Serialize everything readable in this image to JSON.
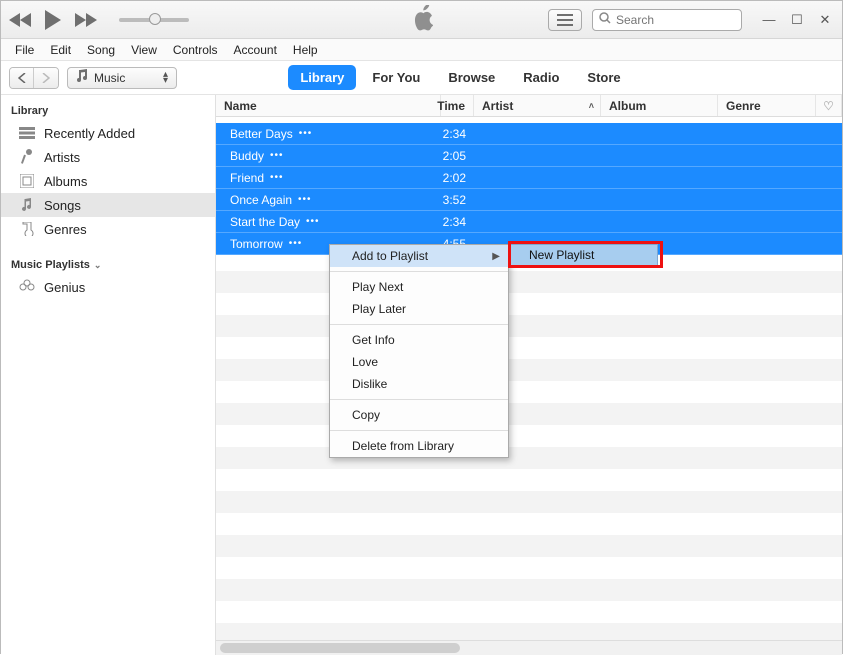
{
  "search": {
    "placeholder": "Search"
  },
  "menubar": [
    "File",
    "Edit",
    "Song",
    "View",
    "Controls",
    "Account",
    "Help"
  ],
  "source_selector": {
    "label": "Music"
  },
  "tabs": [
    {
      "label": "Library",
      "active": true
    },
    {
      "label": "For You",
      "active": false
    },
    {
      "label": "Browse",
      "active": false
    },
    {
      "label": "Radio",
      "active": false
    },
    {
      "label": "Store",
      "active": false
    }
  ],
  "sidebar": {
    "library_heading": "Library",
    "library_items": [
      {
        "label": "Recently Added",
        "icon": "recent"
      },
      {
        "label": "Artists",
        "icon": "artist"
      },
      {
        "label": "Albums",
        "icon": "album"
      },
      {
        "label": "Songs",
        "icon": "song",
        "active": true
      },
      {
        "label": "Genres",
        "icon": "genre"
      }
    ],
    "playlists_heading": "Music Playlists",
    "playlist_items": [
      {
        "label": "Genius",
        "icon": "genius"
      }
    ]
  },
  "columns": {
    "name": "Name",
    "time": "Time",
    "artist": "Artist",
    "album": "Album",
    "genre": "Genre"
  },
  "songs": [
    {
      "name": "Better Days",
      "time": "2:34"
    },
    {
      "name": "Buddy",
      "time": "2:05"
    },
    {
      "name": "Friend",
      "time": "2:02"
    },
    {
      "name": "Once Again",
      "time": "3:52"
    },
    {
      "name": "Start the Day",
      "time": "2:34"
    },
    {
      "name": "Tomorrow",
      "time": "4:55"
    }
  ],
  "context_menu": {
    "items": [
      {
        "label": "Add to Playlist",
        "submenu": true,
        "highlight": true
      },
      {
        "sep": true
      },
      {
        "label": "Play Next"
      },
      {
        "label": "Play Later"
      },
      {
        "sep": true
      },
      {
        "label": "Get Info"
      },
      {
        "label": "Love"
      },
      {
        "label": "Dislike"
      },
      {
        "sep": true
      },
      {
        "label": "Copy"
      },
      {
        "sep": true
      },
      {
        "label": "Delete from Library"
      }
    ],
    "submenu_item": "New Playlist"
  }
}
